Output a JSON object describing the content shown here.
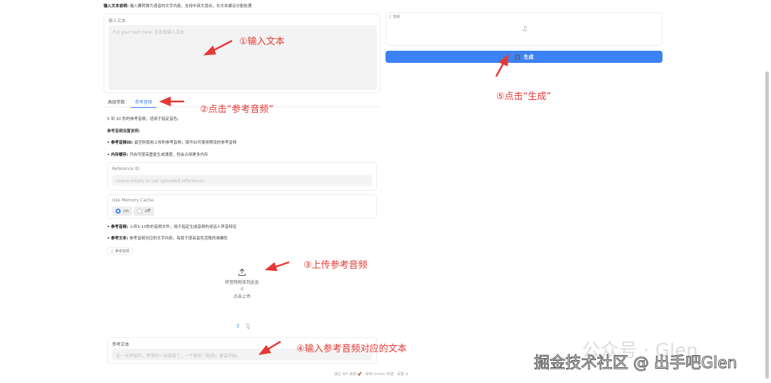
{
  "intro": {
    "label": "输入文本说明:",
    "text": "输入要转换为语音的文字内容，支持中英文混合，长文本建议分割处理"
  },
  "text_input": {
    "label": "输入文本",
    "placeholder": "Put your text here. 在此处输入文本."
  },
  "tabs": [
    {
      "label": "高级参数"
    },
    {
      "label": "参考音频"
    }
  ],
  "ref": {
    "desc": "5 到 10 秒的参考音频，适用于指定音色。",
    "settings_title": "参考音频设置说明:",
    "b1_label": "• 参考音频ID:",
    "b1_text": "留空则使用上传的参考音频，填写ID可使用预设的参考音频",
    "b2_label": "• 内存缓存:",
    "b2_text": "开启可提高重复生成速度，但会占用更多内存",
    "ref_id_label": "Reference ID",
    "ref_id_placeholder": "Leave empty to use uploaded references",
    "cache_label": "Use Memory Cache",
    "opt_on": "on",
    "opt_off": "off",
    "b3_label": "• 参考音频:",
    "b3_text": "上传5-10秒的音频文件，用于指定生成音频的说话人声音特征",
    "b4_label": "• 参考文本:",
    "b4_text": "参考音频对应的文字内容，有助于提高音色克隆的准确性",
    "audio_label": "参考音频",
    "drop_text": "将音频拖放到此处",
    "or": "- 或 -",
    "click_upload": "点击上传",
    "ref_text_label": "参考文本",
    "ref_text_placeholder": "在一无所知中，梦里的一天结束了，一个新的「轮回」便会开始。"
  },
  "output": {
    "label": "音频",
    "generate": "生成"
  },
  "footer": {
    "api": "通过 API 使用",
    "built": "使用 Gradio 构建",
    "settings": "设置"
  },
  "annotations": {
    "a1": "①输入文本",
    "a2": "②点击“参考音频”",
    "a3": "③上传参考音频",
    "a4": "④输入参考音频对应的文本",
    "a5": "⑤点击“生成”"
  },
  "watermark": {
    "main": "掘金技术社区 @ 出手吧Glen",
    "bg": "公众号 · Glen"
  },
  "colors": {
    "accent": "#3b82f6",
    "annotation": "#e53935"
  }
}
